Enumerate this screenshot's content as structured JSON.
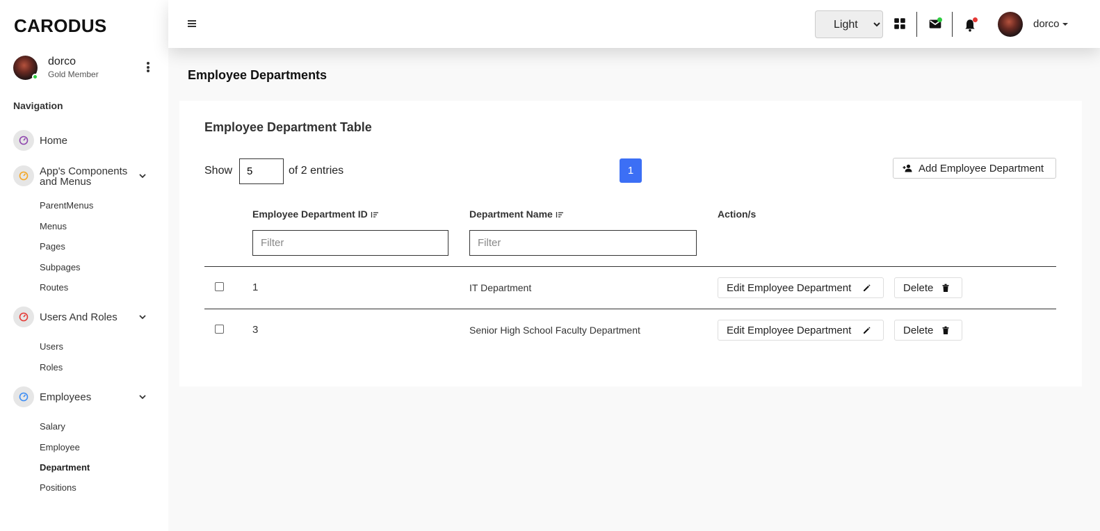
{
  "brand": "CARODUS",
  "profile": {
    "name": "dorco",
    "role": "Gold Member"
  },
  "nav": {
    "heading": "Navigation",
    "home": "Home",
    "app_components": "App's Components and Menus",
    "app_sub": [
      "ParentMenus",
      "Menus",
      "Pages",
      "Subpages",
      "Routes"
    ],
    "users_roles": "Users And Roles",
    "users_sub": [
      "Users",
      "Roles"
    ],
    "employees": "Employees",
    "employees_sub": [
      "Salary",
      "Employee",
      "Department",
      "Positions"
    ],
    "active_item": "Department"
  },
  "topbar": {
    "theme_options": [
      "Light"
    ],
    "theme_selected": "Light",
    "username": "dorco",
    "mail_badge_color": "#2ecc40",
    "bell_badge_color": "#e53935",
    "icons": [
      "menu-icon",
      "grid-icon",
      "mail-icon",
      "bell-icon",
      "avatar",
      "caret-down-icon"
    ]
  },
  "page": {
    "title": "Employee Departments",
    "card_title": "Employee Department Table"
  },
  "table_controls": {
    "show_label": "Show",
    "page_size": "5",
    "entries_label": "of 2 entries",
    "current_page": "1",
    "add_button": "Add Employee Department"
  },
  "table": {
    "columns": [
      "Employee Department ID",
      "Department Name",
      "Action/s"
    ],
    "filter_placeholder": "Filter",
    "rows": [
      {
        "id": "1",
        "name": "IT Department"
      },
      {
        "id": "3",
        "name": "Senior High School Faculty Department"
      }
    ],
    "edit_label": "Edit Employee Department",
    "delete_label": "Delete"
  },
  "colors": {
    "accent": "#3c6ff5",
    "online": "#2ecc40"
  }
}
